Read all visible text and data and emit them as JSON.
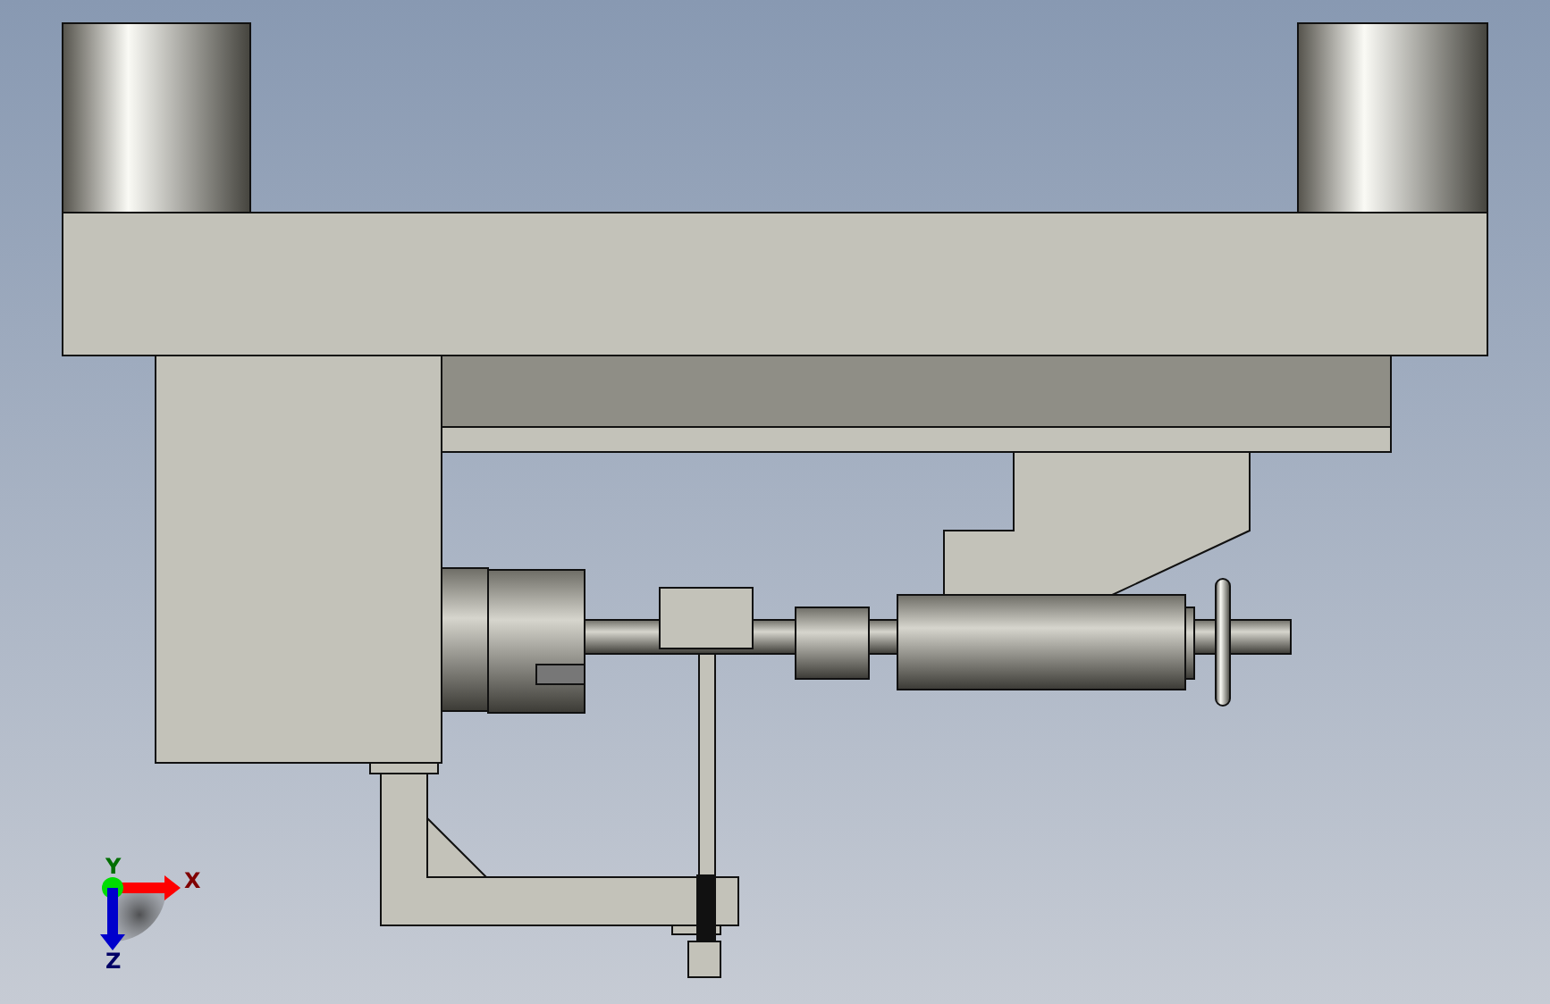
{
  "viewport": {
    "triad": {
      "axes": [
        {
          "label": "X",
          "kind": "right",
          "color": "#ff0000"
        },
        {
          "label": "Y",
          "kind": "point",
          "color": "#00dd00"
        },
        {
          "label": "Z",
          "kind": "down",
          "color": "#0000cc"
        }
      ]
    }
  }
}
